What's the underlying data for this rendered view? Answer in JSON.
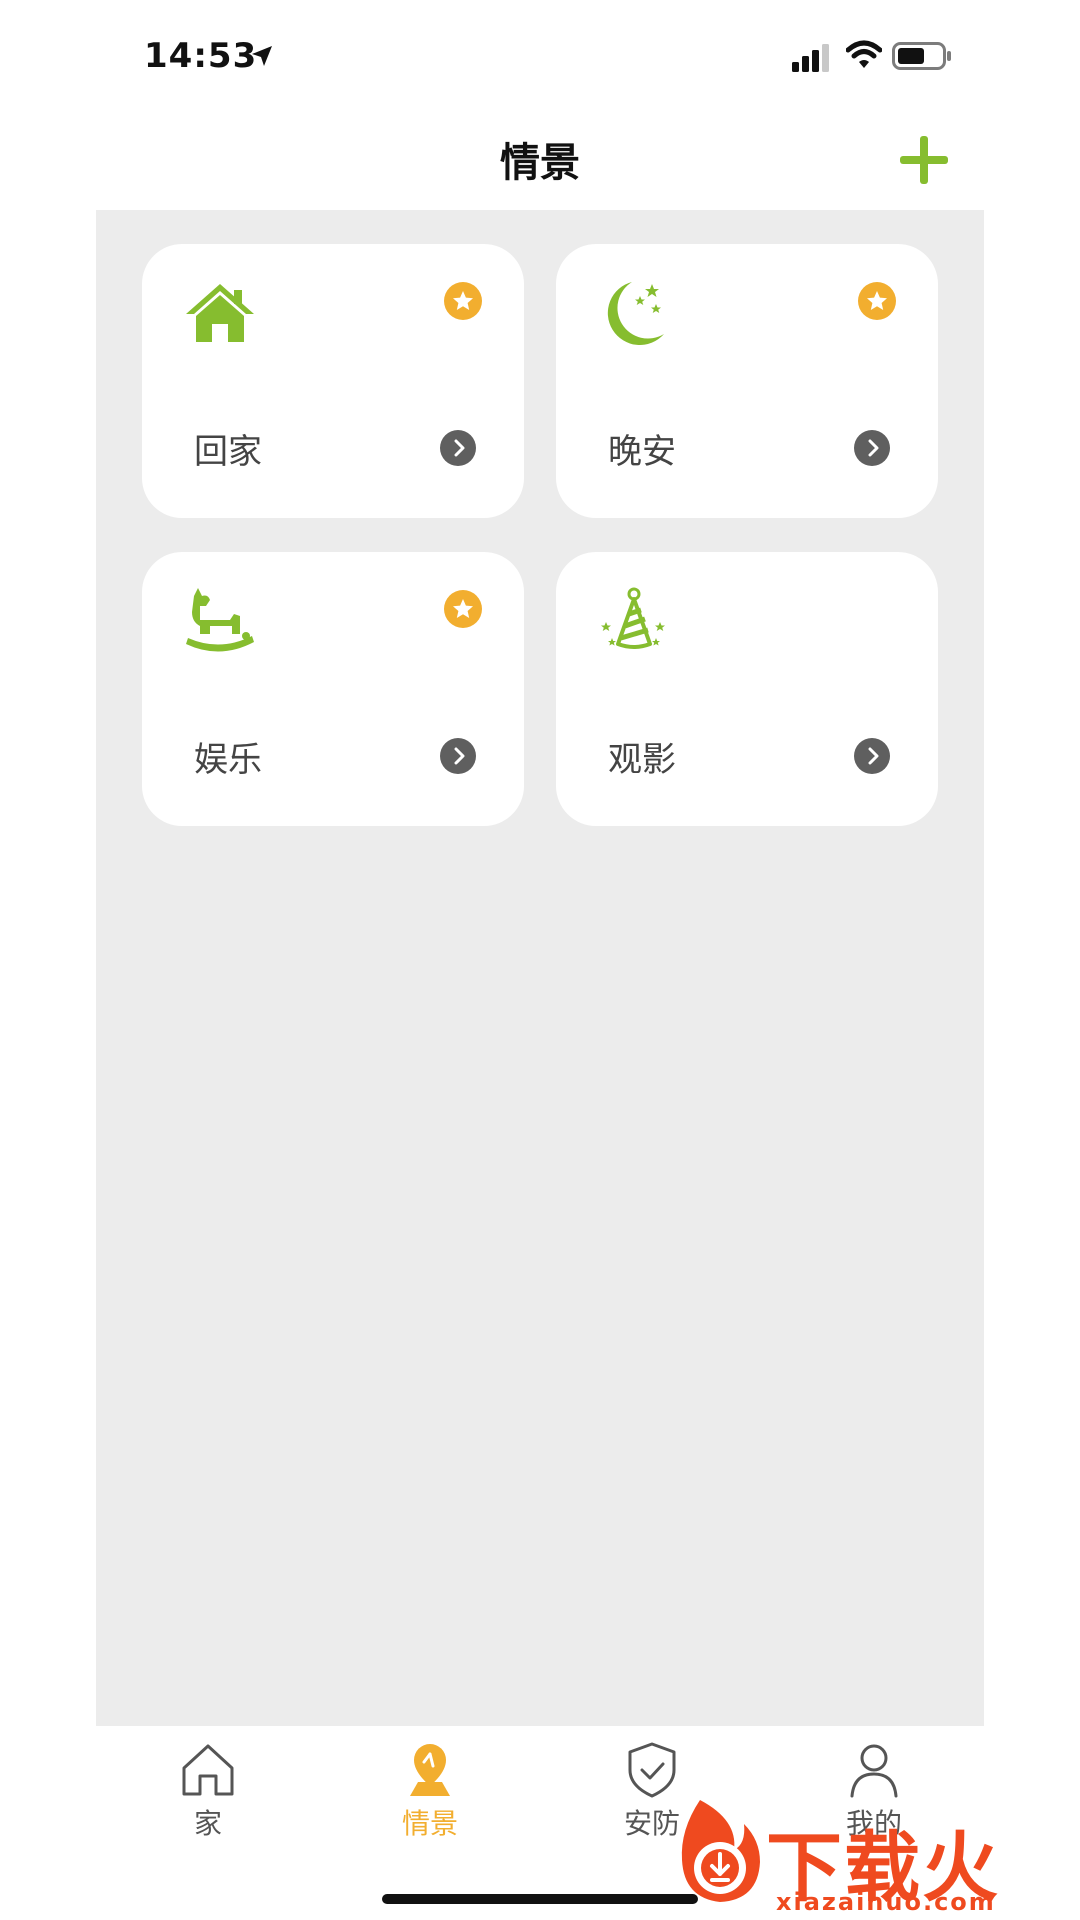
{
  "status": {
    "time": "14:53",
    "icons": [
      "location-arrow-icon",
      "signal-icon",
      "wifi-icon",
      "battery-icon"
    ]
  },
  "header": {
    "title": "情景",
    "add_icon": "plus-icon"
  },
  "scenes": [
    {
      "label": "回家",
      "icon": "house-icon",
      "favorite": true
    },
    {
      "label": "晚安",
      "icon": "moon-stars-icon",
      "favorite": true
    },
    {
      "label": "娱乐",
      "icon": "rocking-horse-icon",
      "favorite": true
    },
    {
      "label": "观影",
      "icon": "party-hat-icon",
      "favorite": false
    }
  ],
  "tabs": [
    {
      "label": "家",
      "icon": "house-outline-icon",
      "active": false
    },
    {
      "label": "情景",
      "icon": "scene-pin-icon",
      "active": true
    },
    {
      "label": "安防",
      "icon": "shield-check-icon",
      "active": false
    },
    {
      "label": "我的",
      "icon": "person-icon",
      "active": false
    }
  ],
  "watermark": {
    "brand": "下载火",
    "url": "xiazaihuo.com"
  },
  "colors": {
    "accent_green": "#86bd2f",
    "favorite_orange": "#f2ae2f",
    "tab_active": "#f2ae2f",
    "tab_inactive": "#555555",
    "panel_bg": "#ececec",
    "watermark_red": "#ef4a1f"
  }
}
